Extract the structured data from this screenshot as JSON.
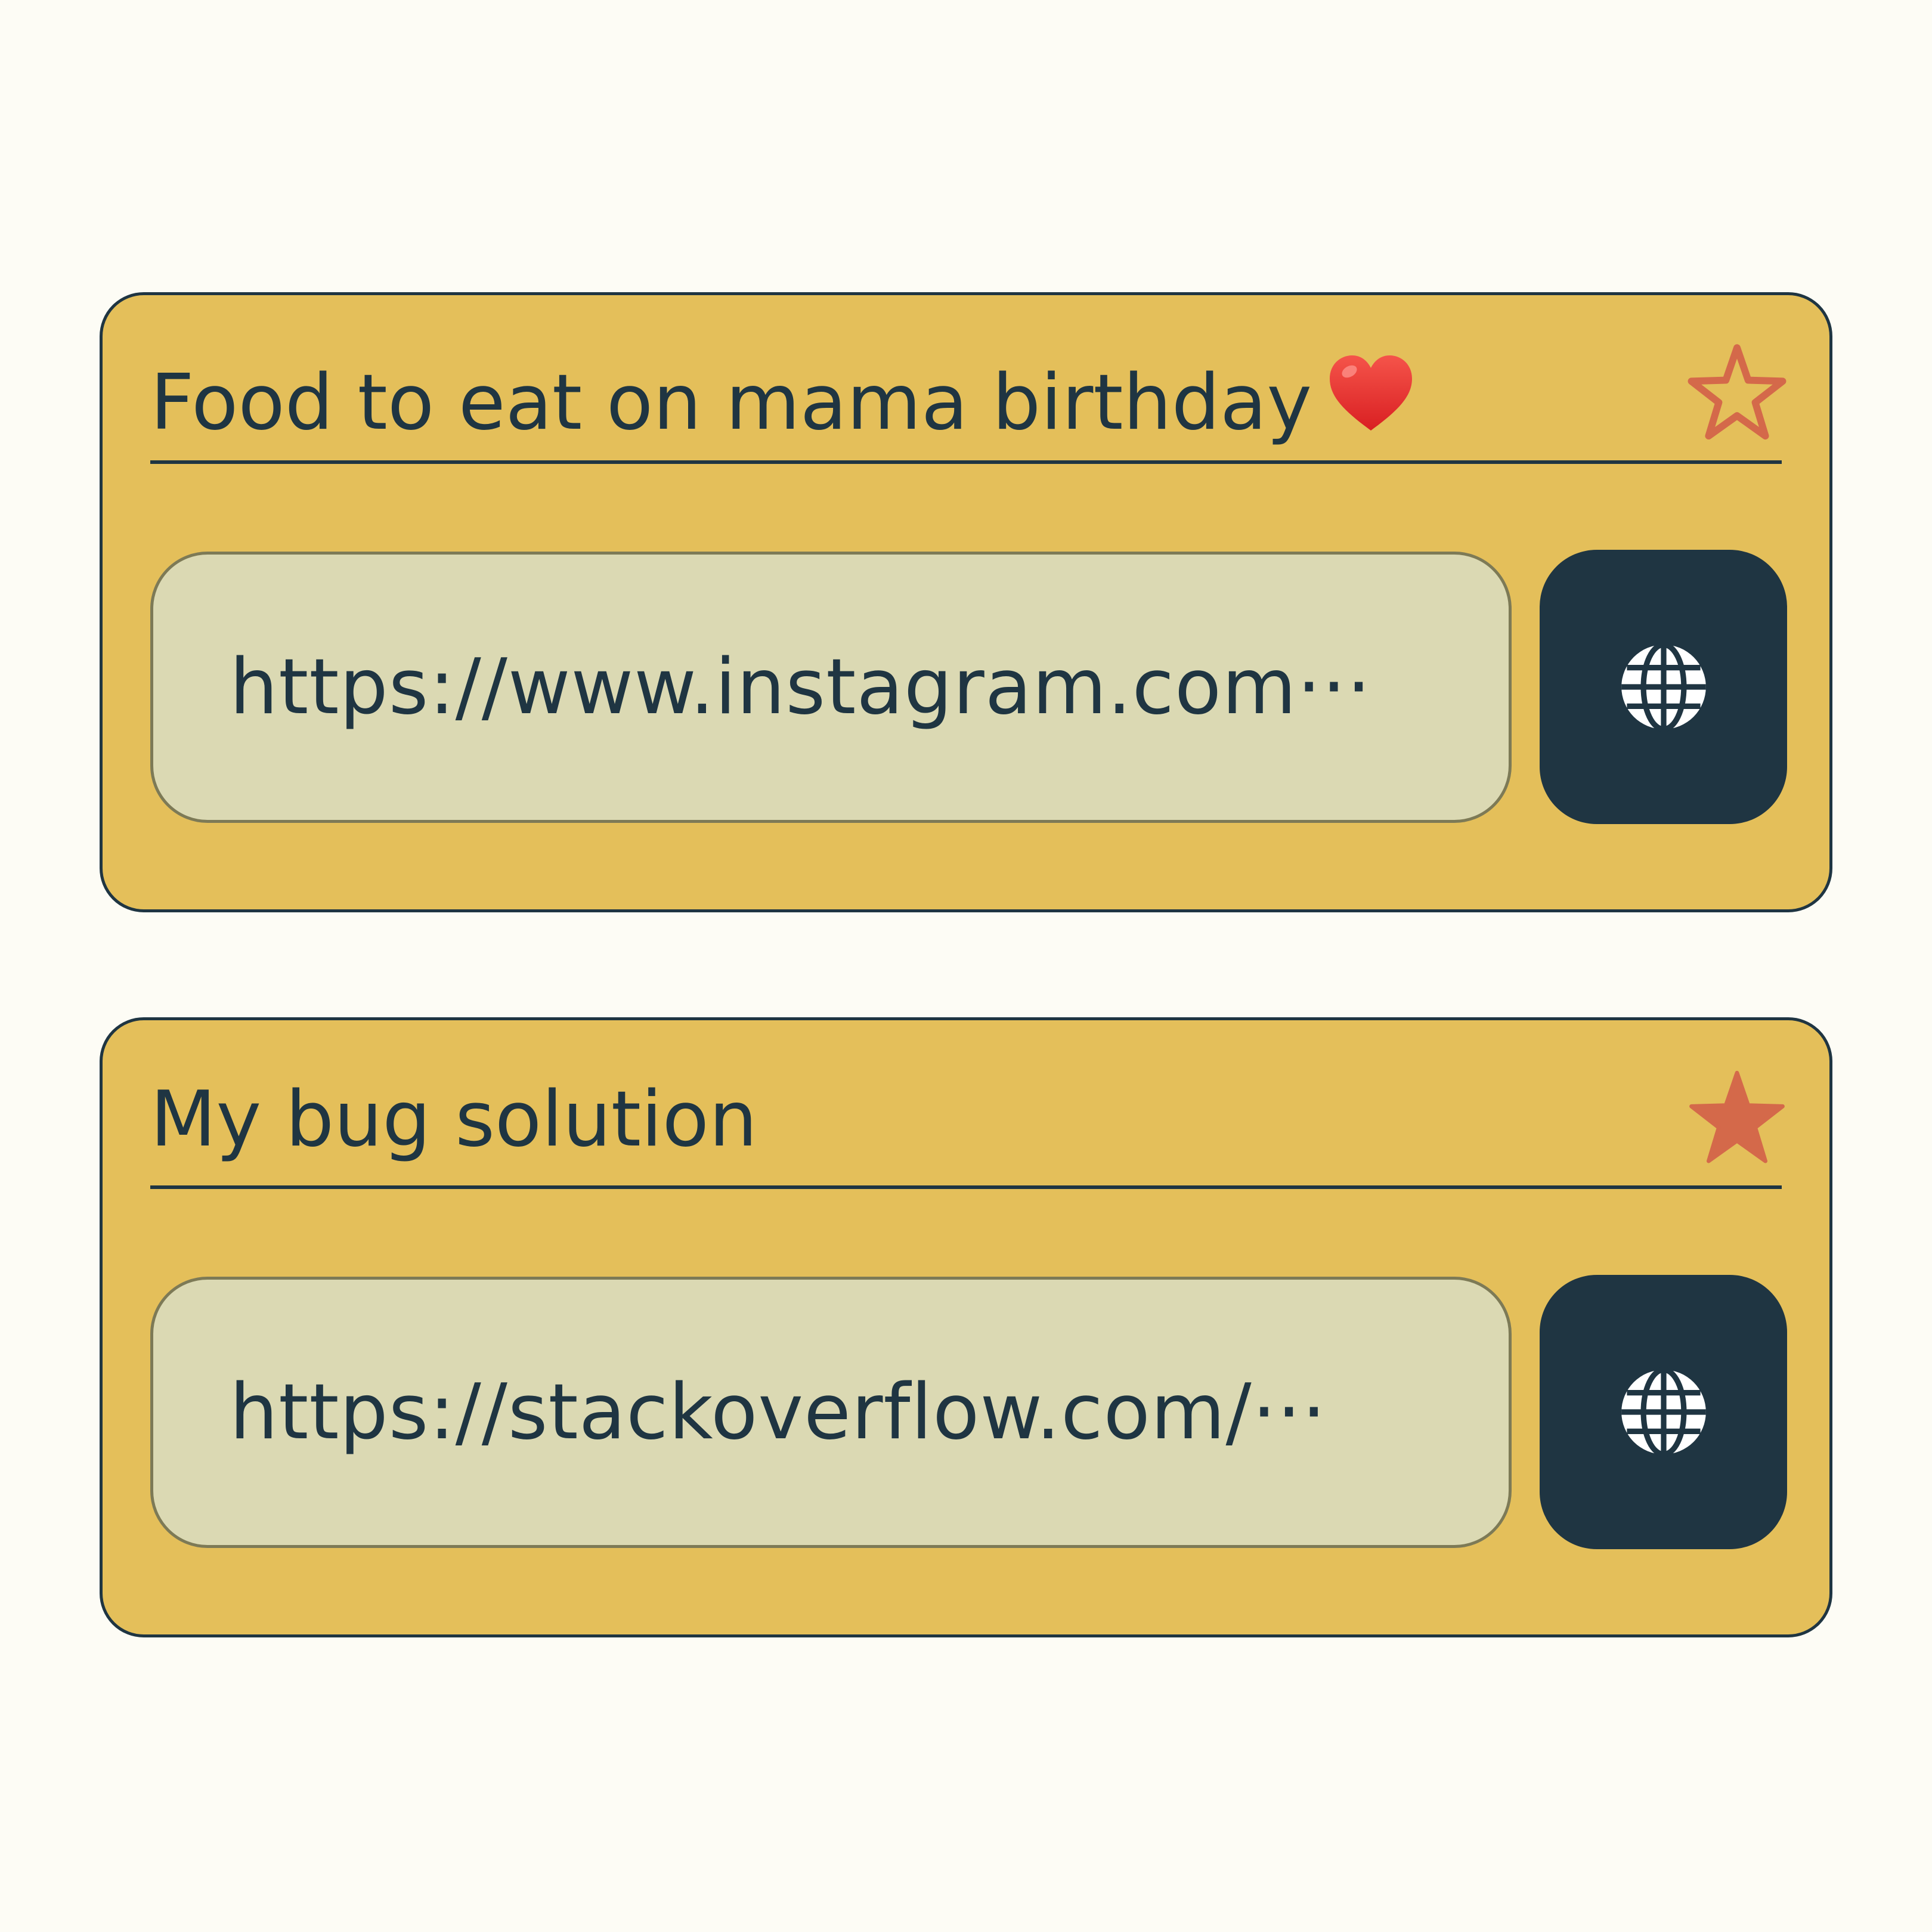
{
  "bookmarks": [
    {
      "title": "Food to eat on mama birthday",
      "title_emoji": "heart-emoji",
      "favorite": false,
      "favorite_icon": "star-outline-icon",
      "url": "https://www.instagram.com···",
      "open_button_icon": "globe-icon"
    },
    {
      "title": "My bug solution",
      "favorite": true,
      "favorite_icon": "star-filled-icon",
      "url": "https://stackoverflow.com/···",
      "open_button_icon": "globe-icon"
    }
  ],
  "colors": {
    "background": "#fdfcf5",
    "card": "#e4bf5a",
    "card_border": "#1f3542",
    "text": "#1f3542",
    "url_field": "#dbd9b3",
    "button": "#1f3542",
    "star": "#d4694a",
    "heart": "#e8322f"
  }
}
